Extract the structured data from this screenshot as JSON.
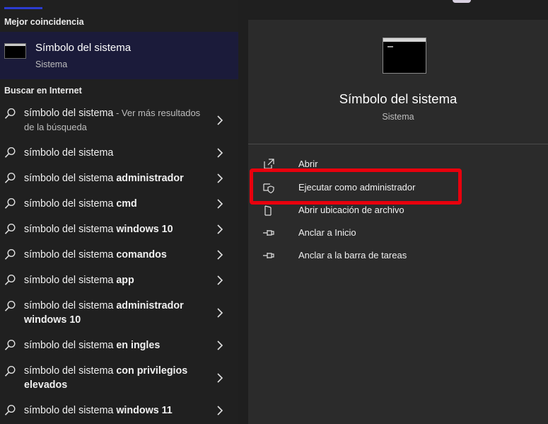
{
  "sections": {
    "best_match_label": "Mejor coincidencia",
    "web_search_label": "Buscar en Internet"
  },
  "best_match": {
    "title": "Símbolo del sistema",
    "subtitle": "Sistema"
  },
  "web_results": [
    {
      "text": "símbolo del sistema",
      "bold": "",
      "suffix": " - Ver más resultados de la búsqueda"
    },
    {
      "text": "símbolo del sistema",
      "bold": "",
      "suffix": ""
    },
    {
      "text": "símbolo del sistema ",
      "bold": "administrador",
      "suffix": ""
    },
    {
      "text": "símbolo del sistema ",
      "bold": "cmd",
      "suffix": ""
    },
    {
      "text": "símbolo del sistema ",
      "bold": "windows 10",
      "suffix": ""
    },
    {
      "text": "símbolo del sistema ",
      "bold": "comandos",
      "suffix": ""
    },
    {
      "text": "símbolo del sistema ",
      "bold": "app",
      "suffix": ""
    },
    {
      "text": "símbolo del sistema ",
      "bold": "administrador windows 10",
      "suffix": ""
    },
    {
      "text": "símbolo del sistema ",
      "bold": "en ingles",
      "suffix": ""
    },
    {
      "text": "símbolo del sistema ",
      "bold": "con privilegios elevados",
      "suffix": ""
    },
    {
      "text": "símbolo del sistema ",
      "bold": "windows 11",
      "suffix": ""
    }
  ],
  "detail": {
    "title": "Símbolo del sistema",
    "subtitle": "Sistema",
    "actions": [
      {
        "label": "Abrir",
        "icon": "open-icon"
      },
      {
        "label": "Ejecutar como administrador",
        "icon": "shield-icon"
      },
      {
        "label": "Abrir ubicación de archivo",
        "icon": "folder-icon"
      },
      {
        "label": "Anclar a Inicio",
        "icon": "pin-icon"
      },
      {
        "label": "Anclar a la barra de tareas",
        "icon": "pin-icon"
      }
    ]
  },
  "colors": {
    "highlight": "#e8000d",
    "selected_bg": "#1b1b3a",
    "tab_indicator": "#2b3cd1"
  }
}
